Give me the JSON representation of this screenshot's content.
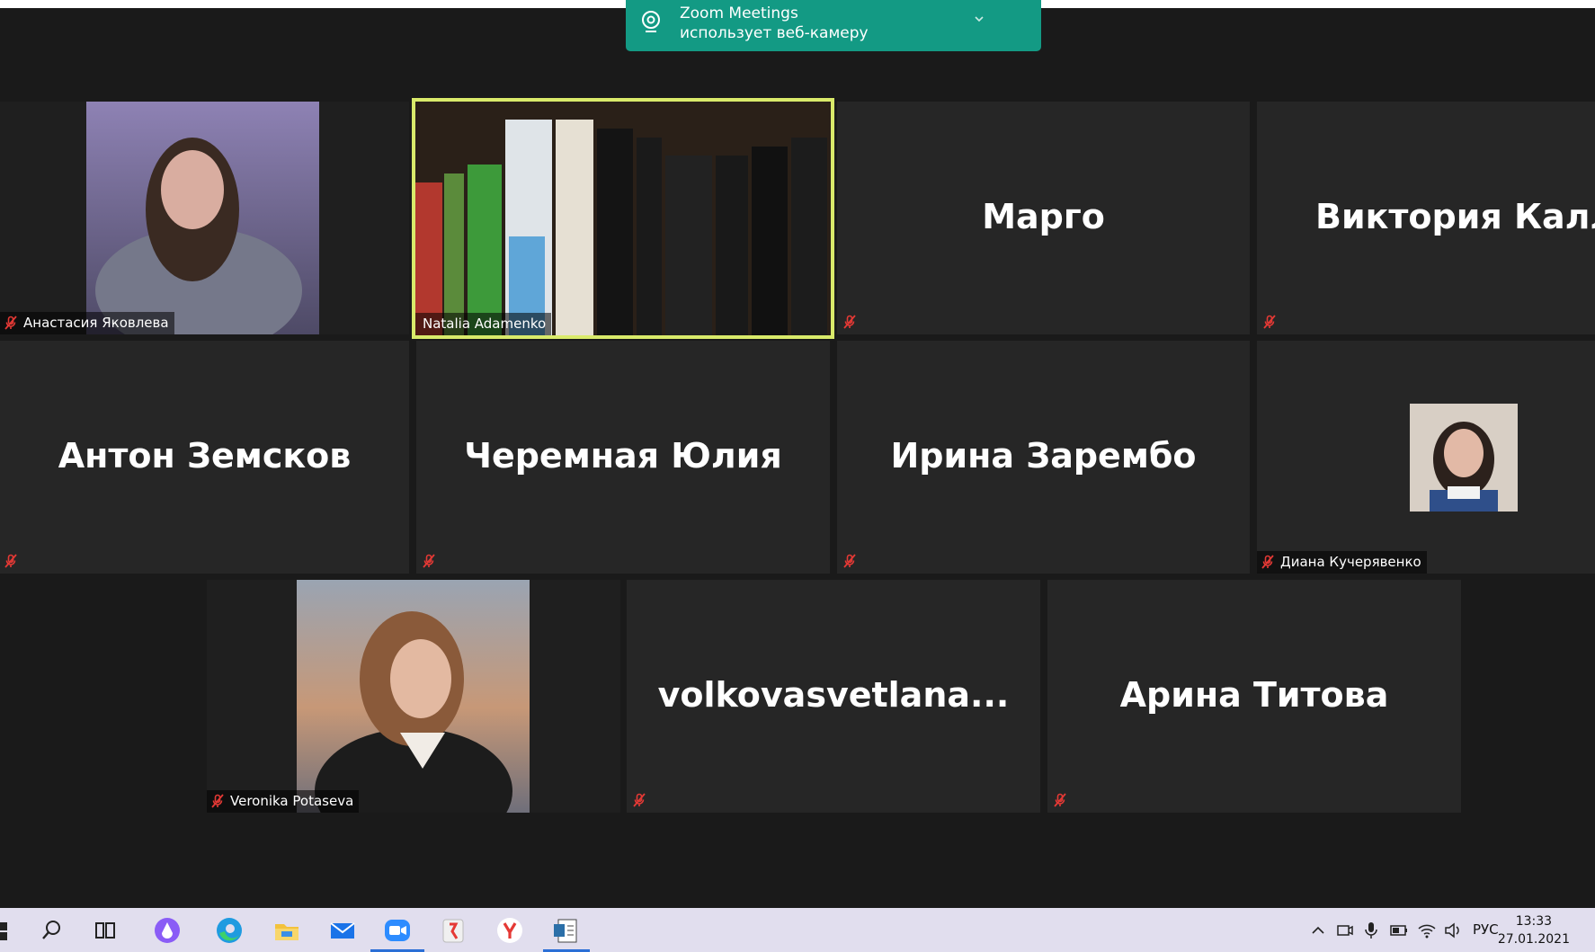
{
  "notification": {
    "title": "Zoom Meetings",
    "text": "использует веб-камеру"
  },
  "gallery": {
    "tiles": [
      {
        "label": "Анастасия Яковлева",
        "video": true
      },
      {
        "label": "Natalia Adamenko",
        "video": true,
        "active_speaker": true
      },
      {
        "display_name": "Марго",
        "video": false
      },
      {
        "display_name": "Виктория  Калл...",
        "video": false
      },
      {
        "display_name": "Антон Земсков",
        "video": false
      },
      {
        "display_name": "Черемная Юлия",
        "video": false
      },
      {
        "display_name": "Ирина Зарембо",
        "video": false
      },
      {
        "label": "Диана Кучерявенко",
        "video": true
      },
      {
        "label": "Veronika Potaseva",
        "video": true
      },
      {
        "display_name": "volkovasvetlana...",
        "video": false
      },
      {
        "display_name": "Арина Титова",
        "video": false
      }
    ]
  },
  "taskbar": {
    "icons": [
      "windows-start-icon",
      "search-icon",
      "task-view-icon",
      "alice-icon",
      "edge-icon",
      "file-explorer-icon",
      "mail-icon",
      "zoom-icon",
      "yandex-browser-icon",
      "yandex-icon",
      "document-app-icon"
    ],
    "tray": {
      "language": "РУС",
      "time": "13:33",
      "date": "27.01.2021"
    }
  },
  "colors": {
    "background": "#1a1a1a",
    "tile": "#262626",
    "notification": "#139a84",
    "active_border": "#d9ea6a",
    "muted_mic": "#e53935",
    "taskbar": "#e1deee"
  }
}
